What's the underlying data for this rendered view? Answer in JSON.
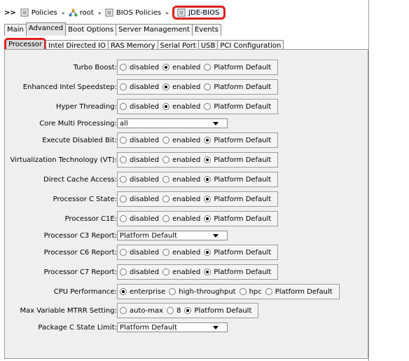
{
  "breadcrumb": {
    "prefix": ">>",
    "items": [
      {
        "label": "Policies",
        "icon": "policy-icon"
      },
      {
        "label": "root",
        "icon": "org-tree-icon"
      },
      {
        "label": "BIOS Policies",
        "icon": "policy-icon"
      },
      {
        "label": "JDE-BIOS",
        "icon": "policy-icon"
      }
    ]
  },
  "tabs": [
    "Main",
    "Advanced",
    "Boot Options",
    "Server Management",
    "Events"
  ],
  "subtabs": [
    "Processor",
    "Intel Directed IO",
    "RAS Memory",
    "Serial Port",
    "USB",
    "PCI Configuration"
  ],
  "settings": {
    "turbo_boost": {
      "label": "Turbo Boost:",
      "options": [
        "disabled",
        "enabled",
        "Platform Default"
      ],
      "selected": "enabled"
    },
    "speedstep": {
      "label": "Enhanced Intel Speedstep:",
      "options": [
        "disabled",
        "enabled",
        "Platform Default"
      ],
      "selected": "enabled"
    },
    "hyper_threading": {
      "label": "Hyper Threading:",
      "options": [
        "disabled",
        "enabled",
        "Platform Default"
      ],
      "selected": "enabled"
    },
    "core_multi": {
      "label": "Core Multi Processing:",
      "value": "all"
    },
    "execute_disabled": {
      "label": "Execute Disabled Bit:",
      "options": [
        "disabled",
        "enabled",
        "Platform Default"
      ],
      "selected": "Platform Default"
    },
    "vt": {
      "label": "Virtualization Technology (VT):",
      "options": [
        "disabled",
        "enabled",
        "Platform Default"
      ],
      "selected": "Platform Default"
    },
    "dca": {
      "label": "Direct Cache Access:",
      "options": [
        "disabled",
        "enabled",
        "Platform Default"
      ],
      "selected": "Platform Default"
    },
    "c_state": {
      "label": "Processor C State:",
      "options": [
        "disabled",
        "enabled",
        "Platform Default"
      ],
      "selected": "Platform Default"
    },
    "c1e": {
      "label": "Processor C1E:",
      "options": [
        "disabled",
        "enabled",
        "Platform Default"
      ],
      "selected": "Platform Default"
    },
    "c3_report": {
      "label": "Processor C3 Report:",
      "value": "Platform Default"
    },
    "c6_report": {
      "label": "Processor C6 Report:",
      "options": [
        "disabled",
        "enabled",
        "Platform Default"
      ],
      "selected": "Platform Default"
    },
    "c7_report": {
      "label": "Processor C7 Report:",
      "options": [
        "disabled",
        "enabled",
        "Platform Default"
      ],
      "selected": "Platform Default"
    },
    "cpu_perf": {
      "label": "CPU Performance:",
      "options": [
        "enterprise",
        "high-throughput",
        "hpc",
        "Platform Default"
      ],
      "selected": "enterprise"
    },
    "mtrr": {
      "label": "Max Variable MTRR Setting:",
      "options": [
        "auto-max",
        "8",
        "Platform Default"
      ],
      "selected": "Platform Default"
    },
    "pkg_c_state": {
      "label": "Package C State Limit:",
      "value": "Platform Default"
    }
  },
  "colors": {
    "highlight": "#e02020",
    "panel": "#efefef"
  }
}
